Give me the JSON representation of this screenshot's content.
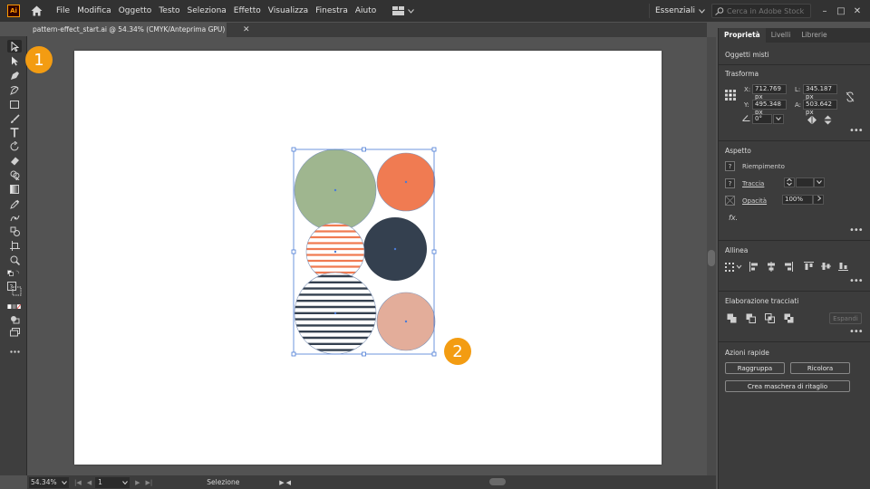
{
  "app": {
    "logo": "Ai",
    "home_icon": "home-icon"
  },
  "menu": [
    "File",
    "Modifica",
    "Oggetto",
    "Testo",
    "Seleziona",
    "Effetto",
    "Visualizza",
    "Finestra",
    "Aiuto"
  ],
  "workspace": {
    "label": "Essenziali"
  },
  "search": {
    "placeholder": "Cerca in Adobe Stock"
  },
  "window": {
    "minimize": "–",
    "maximize": "□",
    "close": "✕"
  },
  "document": {
    "tab_title": "pattern-effect_start.ai @ 54.34% (CMYK/Anteprima GPU)",
    "close": "✕"
  },
  "badges": {
    "one": "1",
    "two": "2"
  },
  "colors": {
    "accent": "#f39c12",
    "green": "#9fb68f",
    "orange": "#f07b52",
    "navy": "#34404f",
    "peach": "#e3ad9a",
    "selection": "#4a7bd6"
  },
  "status": {
    "zoom": "54.34%",
    "page": "1",
    "mode": "Selezione"
  },
  "panel": {
    "tabs": [
      "Proprietà",
      "Livelli",
      "Librerie"
    ],
    "object_type": "Oggetti misti",
    "transform": {
      "title": "Trasforma",
      "x_label": "X:",
      "x": "712.769 px",
      "y_label": "Y:",
      "y": "495.348 px",
      "l_label": "L:",
      "l": "345.187 px",
      "a_label": "A:",
      "a": "503.642 px",
      "angle": "0°"
    },
    "appearance": {
      "title": "Aspetto",
      "fill": "Riempimento",
      "stroke": "Traccia",
      "opacity_label": "Opacità",
      "opacity": "100%",
      "unknown": "?",
      "fx": "fx."
    },
    "align": {
      "title": "Allinea"
    },
    "pathfinder": {
      "title": "Elaborazione tracciati",
      "expand": "Espandi"
    },
    "quick_actions": {
      "title": "Azioni rapide",
      "group": "Raggruppa",
      "recolor": "Ricolora",
      "clip_mask": "Crea maschera di ritaglio"
    }
  }
}
